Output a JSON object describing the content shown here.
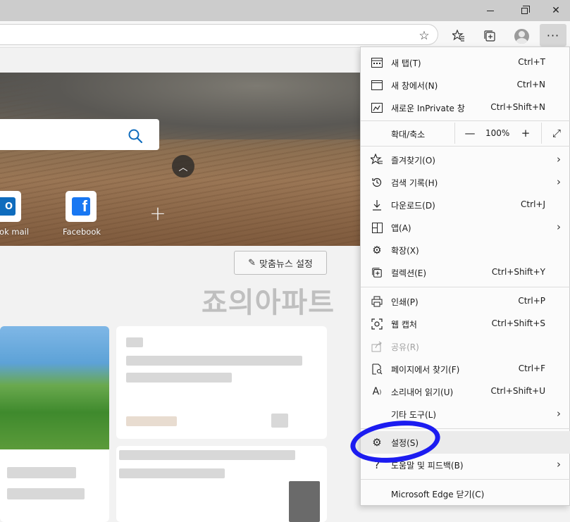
{
  "toolbar": {
    "more_label": "···"
  },
  "page": {
    "tiles": [
      {
        "label": "Outlook mail",
        "visible_label": "ook mail",
        "logo_text": "O"
      },
      {
        "label": "Facebook",
        "logo_text": "f"
      }
    ],
    "news_button": "맞춤뉴스 설정",
    "watermark": "죠의아파트"
  },
  "menu": {
    "items": [
      {
        "label": "새 탭(T)",
        "shortcut": "Ctrl+T"
      },
      {
        "label": "새 창에서(N)",
        "shortcut": "Ctrl+N"
      },
      {
        "label": "새로운 InPrivate 창",
        "shortcut": "Ctrl+Shift+N"
      },
      {
        "label": "즐겨찾기(O)",
        "shortcut": ""
      },
      {
        "label": "검색 기록(H)",
        "shortcut": ""
      },
      {
        "label": "다운로드(D)",
        "shortcut": "Ctrl+J"
      },
      {
        "label": "앱(A)",
        "shortcut": ""
      },
      {
        "label": "확장(X)",
        "shortcut": ""
      },
      {
        "label": "컬렉션(E)",
        "shortcut": "Ctrl+Shift+Y"
      },
      {
        "label": "인쇄(P)",
        "shortcut": "Ctrl+P"
      },
      {
        "label": "웹 캡처",
        "shortcut": "Ctrl+Shift+S"
      },
      {
        "label": "공유(R)",
        "shortcut": ""
      },
      {
        "label": "페이지에서 찾기(F)",
        "shortcut": "Ctrl+F"
      },
      {
        "label": "소리내어 읽기(U)",
        "shortcut": "Ctrl+Shift+U"
      },
      {
        "label": "기타 도구(L)",
        "shortcut": ""
      },
      {
        "label": "설정(S)",
        "shortcut": ""
      },
      {
        "label": "도움말 및 피드백(B)",
        "shortcut": ""
      },
      {
        "label": "Microsoft Edge 닫기(C)",
        "shortcut": ""
      }
    ],
    "zoom": {
      "label": "확대/축소",
      "value": "100%",
      "minus": "—",
      "plus": "+"
    }
  },
  "colors": {
    "annotation": "#1c1cf0",
    "facebook": "#1877f2",
    "outlook": "#0f6cbd"
  }
}
